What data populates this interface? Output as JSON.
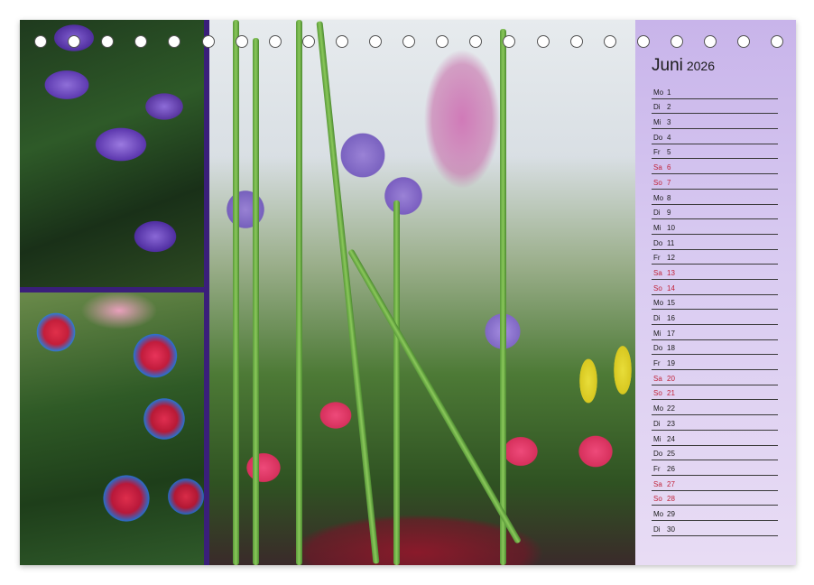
{
  "calendar": {
    "month": "Juni",
    "year": "2026",
    "days": [
      {
        "wd": "Mo",
        "d": "1",
        "weekend": false
      },
      {
        "wd": "Di",
        "d": "2",
        "weekend": false
      },
      {
        "wd": "Mi",
        "d": "3",
        "weekend": false
      },
      {
        "wd": "Do",
        "d": "4",
        "weekend": false
      },
      {
        "wd": "Fr",
        "d": "5",
        "weekend": false
      },
      {
        "wd": "Sa",
        "d": "6",
        "weekend": true
      },
      {
        "wd": "So",
        "d": "7",
        "weekend": true
      },
      {
        "wd": "Mo",
        "d": "8",
        "weekend": false
      },
      {
        "wd": "Di",
        "d": "9",
        "weekend": false
      },
      {
        "wd": "Mi",
        "d": "10",
        "weekend": false
      },
      {
        "wd": "Do",
        "d": "11",
        "weekend": false
      },
      {
        "wd": "Fr",
        "d": "12",
        "weekend": false
      },
      {
        "wd": "Sa",
        "d": "13",
        "weekend": true
      },
      {
        "wd": "So",
        "d": "14",
        "weekend": true
      },
      {
        "wd": "Mo",
        "d": "15",
        "weekend": false
      },
      {
        "wd": "Di",
        "d": "16",
        "weekend": false
      },
      {
        "wd": "Mi",
        "d": "17",
        "weekend": false
      },
      {
        "wd": "Do",
        "d": "18",
        "weekend": false
      },
      {
        "wd": "Fr",
        "d": "19",
        "weekend": false
      },
      {
        "wd": "Sa",
        "d": "20",
        "weekend": true
      },
      {
        "wd": "So",
        "d": "21",
        "weekend": true
      },
      {
        "wd": "Mo",
        "d": "22",
        "weekend": false
      },
      {
        "wd": "Di",
        "d": "23",
        "weekend": false
      },
      {
        "wd": "Mi",
        "d": "24",
        "weekend": false
      },
      {
        "wd": "Do",
        "d": "25",
        "weekend": false
      },
      {
        "wd": "Fr",
        "d": "26",
        "weekend": false
      },
      {
        "wd": "Sa",
        "d": "27",
        "weekend": true
      },
      {
        "wd": "So",
        "d": "28",
        "weekend": true
      },
      {
        "wd": "Mo",
        "d": "29",
        "weekend": false
      },
      {
        "wd": "Di",
        "d": "30",
        "weekend": false
      }
    ]
  },
  "colors": {
    "weekend_text": "#c0243a",
    "panel_bg": "#d9cbf1",
    "frame": "#3a1f7a"
  }
}
